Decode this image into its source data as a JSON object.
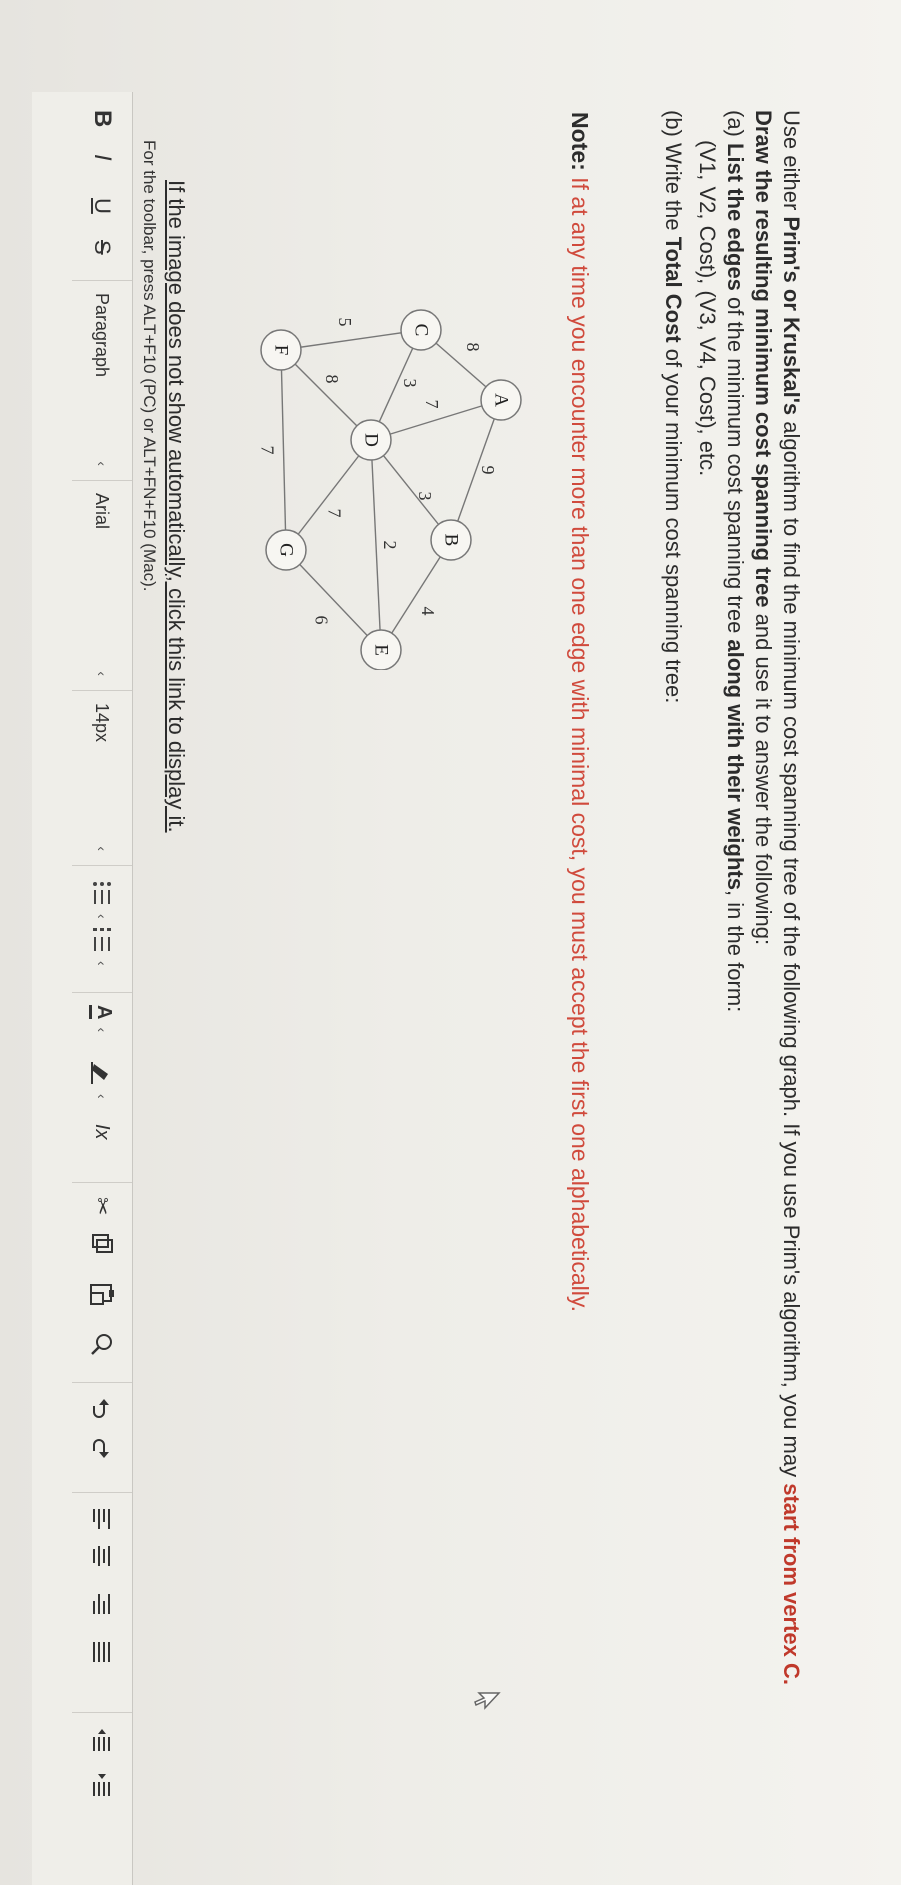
{
  "question": {
    "l1_a": "Use either ",
    "l1_b": "Prim's or Kruskal's",
    "l1_c": " algorithm to find the minimum cost spanning tree of the following graph.  If you use Prim's algorithm, you may ",
    "l1_d": "start from vertex C.",
    "l2_a": "Draw the resulting minimum cost spanning tree",
    "l2_b": " and use it to answer the following:",
    "l3_a": "(a) ",
    "l3_b": "List the edges",
    "l3_c": " of the minimum cost spanning tree ",
    "l3_d": "along with their weights",
    "l3_e": ", in the form:",
    "l4": "(V1, V2, Cost), (V3, V4, Cost), etc.",
    "l5_a": "(b) Write the ",
    "l5_b": "Total Cost",
    "l5_c": " of your minimum cost spanning tree:"
  },
  "note": {
    "label": "Note:",
    "text": " If at any time you encounter more than one edge with minimal cost, you must accept the first one alphabetically."
  },
  "graph": {
    "nodes": [
      "A",
      "B",
      "C",
      "D",
      "E",
      "F",
      "G"
    ],
    "edges": [
      {
        "from": "A",
        "to": "B",
        "weight": "9"
      },
      {
        "from": "A",
        "to": "C",
        "weight": "8"
      },
      {
        "from": "A",
        "to": "D",
        "weight": "7"
      },
      {
        "from": "B",
        "to": "D",
        "weight": "3"
      },
      {
        "from": "B",
        "to": "E",
        "weight": "4"
      },
      {
        "from": "C",
        "to": "D",
        "weight": "3"
      },
      {
        "from": "C",
        "to": "F",
        "weight": "5"
      },
      {
        "from": "D",
        "to": "E",
        "weight": "2"
      },
      {
        "from": "D",
        "to": "F",
        "weight": "8"
      },
      {
        "from": "D",
        "to": "G",
        "weight": "7"
      },
      {
        "from": "F",
        "to": "G",
        "weight": "7"
      },
      {
        "from": "E",
        "to": "G",
        "weight": "6"
      }
    ]
  },
  "image_link": "If the image does not show automatically, click this link to display it.",
  "toolbar_hint": "For the toolbar, press ALT+F10 (PC) or ALT+FN+F10 (Mac).",
  "toolbar": {
    "bold": "B",
    "italic": "I",
    "underline": "U",
    "strike": "S",
    "paragraph": "Paragraph",
    "font": "Arial",
    "size": "14px",
    "caret": "‹",
    "text_color_glyph": "A",
    "clear_format_glyph": "Ix",
    "cut_glyph": "✂"
  }
}
